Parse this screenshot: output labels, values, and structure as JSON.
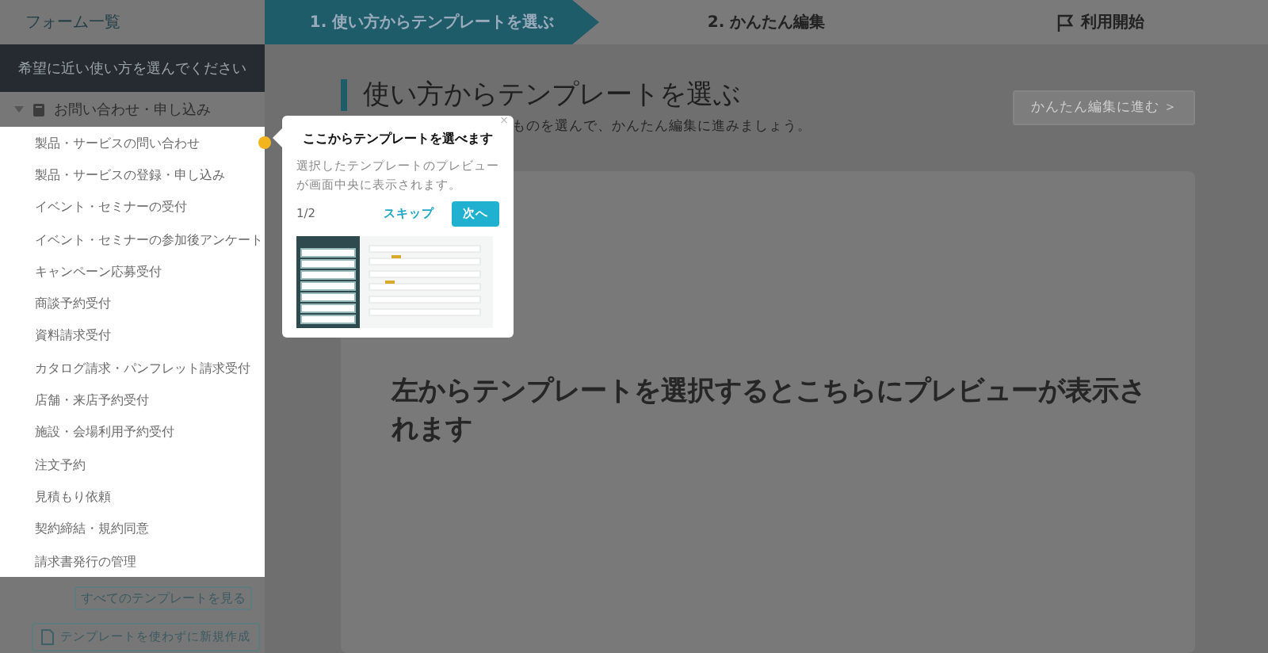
{
  "sidebar": {
    "header_link": "フォーム一覧",
    "prompt": "希望に近い使い方を選んでください",
    "category": {
      "label": "お問い合わせ・申し込み",
      "expanded": true
    },
    "items": [
      {
        "label": "製品・サービスの問い合わせ",
        "highlighted": true
      },
      {
        "label": "製品・サービスの登録・申し込み",
        "highlighted": false
      },
      {
        "label": "イベント・セミナーの受付",
        "highlighted": false
      },
      {
        "label": "イベント・セミナーの参加後アンケート",
        "highlighted": false
      },
      {
        "label": "キャンペーン応募受付",
        "highlighted": false
      },
      {
        "label": "商談予約受付",
        "highlighted": false
      },
      {
        "label": "資料請求受付",
        "highlighted": false
      },
      {
        "label": "カタログ請求・パンフレット請求受付",
        "highlighted": false
      },
      {
        "label": "店舗・来店予約受付",
        "highlighted": false
      },
      {
        "label": "施設・会場利用予約受付",
        "highlighted": false
      },
      {
        "label": "注文予約",
        "highlighted": false
      },
      {
        "label": "見積もり依頼",
        "highlighted": false
      },
      {
        "label": "契約締結・規約同意",
        "highlighted": false
      },
      {
        "label": "請求書発行の管理",
        "highlighted": false
      }
    ],
    "all_templates_button": "すべてのテンプレートを見る",
    "blank_button": "テンプレートを使わずに新規作成"
  },
  "steps": [
    {
      "label": "1. 使い方からテンプレートを選ぶ",
      "selected": true,
      "kind": "text"
    },
    {
      "label": "2. かんたん編集",
      "selected": false,
      "kind": "text"
    },
    {
      "label": "利用開始",
      "selected": false,
      "kind": "flag"
    }
  ],
  "main": {
    "title": "使い方からテンプレートを選ぶ",
    "subtitle": "ものを選んで、かんたん編集に進みましょう。",
    "next_button": "かんたん編集に進む ＞",
    "preview_message": "左からテンプレートを選択するとこちらにプレビューが表示されます"
  },
  "tour_popover": {
    "title": "ここからテンプレートを選べます",
    "body": "選択したテンプレートのプレビューが画面中央に表示されます。",
    "counter": "1/2",
    "skip": "スキップ",
    "next": "次へ",
    "close": "×"
  }
}
